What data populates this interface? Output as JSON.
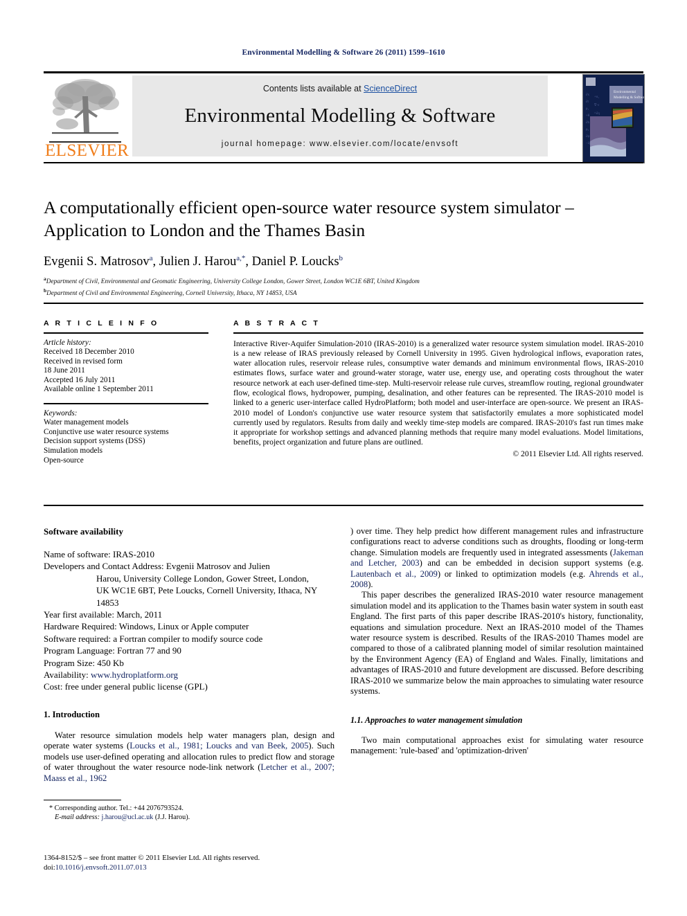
{
  "running_head": "Environmental Modelling & Software 26 (2011) 1599–1610",
  "masthead": {
    "contents_prefix": "Contents lists available at ",
    "sciencedirect": "ScienceDirect",
    "journal_title": "Environmental Modelling & Software",
    "homepage": "journal homepage: www.elsevier.com/locate/envsoft",
    "publisher": "ELSEVIER",
    "cover_title": "Environmental Modelling & Software",
    "accent_orange": "#f07d1a",
    "link_blue": "#1a4fa0",
    "cover_navy": "#0f1f4a"
  },
  "title": "A computationally efficient open-source water resource system simulator – Application to London and the Thames Basin",
  "authors": [
    {
      "name": "Evgenii S. Matrosov",
      "sup": "a"
    },
    {
      "name": "Julien J. Harou",
      "sup": "a,*"
    },
    {
      "name": "Daniel P. Loucks",
      "sup": "b"
    }
  ],
  "affiliations": [
    {
      "mark": "a",
      "text": "Department of Civil, Environmental and Geomatic Engineering, University College London, Gower Street, London WC1E 6BT, United Kingdom"
    },
    {
      "mark": "b",
      "text": "Department of Civil and Environmental Engineering, Cornell University, Ithaca, NY 14853, USA"
    }
  ],
  "article_info": {
    "heading": "A R T I C L E    I N F O",
    "history_label": "Article history:",
    "history": [
      "Received 18 December 2010",
      "Received in revised form",
      "18 June 2011",
      "Accepted 16 July 2011",
      "Available online 1 September 2011"
    ],
    "keywords_label": "Keywords:",
    "keywords": [
      "Water management models",
      "Conjunctive use water resource systems",
      "Decision support systems (DSS)",
      "Simulation models",
      "Open-source"
    ]
  },
  "abstract": {
    "heading": "A B S T R A C T",
    "text": "Interactive River-Aquifer Simulation-2010 (IRAS-2010) is a generalized water resource system simulation model. IRAS-2010 is a new release of IRAS previously released by Cornell University in 1995. Given hydrological inflows, evaporation rates, water allocation rules, reservoir release rules, consumptive water demands and minimum environmental flows, IRAS-2010 estimates flows, surface water and ground-water storage, water use, energy use, and operating costs throughout the water resource network at each user-defined time-step. Multi-reservoir release rule curves, streamflow routing, regional groundwater flow, ecological flows, hydropower, pumping, desalination, and other features can be represented. The IRAS-2010 model is linked to a generic user-interface called HydroPlatform; both model and user-interface are open-source. We present an IRAS-2010 model of London's conjunctive use water resource system that satisfactorily emulates a more sophisticated model currently used by regulators. Results from daily and weekly time-step models are compared. IRAS-2010's fast run times make it appropriate for workshop settings and advanced planning methods that require many model evaluations. Model limitations, benefits, project organization and future plans are outlined.",
    "copyright": "© 2011 Elsevier Ltd. All rights reserved."
  },
  "software_availability": {
    "heading": "Software availability",
    "items": [
      {
        "label": "Name of software:",
        "value": " IRAS-2010"
      },
      {
        "label": "Developers and Contact Address:",
        "value": " Evgenii Matrosov and Julien"
      },
      {
        "label": "",
        "value": "Harou, University College London, Gower Street, London,",
        "indent": true
      },
      {
        "label": "",
        "value": "UK WC1E 6BT, Pete Loucks, Cornell University, Ithaca, NY",
        "indent": true
      },
      {
        "label": "",
        "value": "14853",
        "indent": true
      },
      {
        "label": "Year first available:",
        "value": " March, 2011"
      },
      {
        "label": "Hardware Required:",
        "value": " Windows, Linux or Apple computer"
      },
      {
        "label": "Software required:",
        "value": " a Fortran compiler to modify source code"
      },
      {
        "label": "Program Language:",
        "value": " Fortran 77 and 90"
      },
      {
        "label": "Program Size:",
        "value": " 450 Kb"
      },
      {
        "label": "Availability:",
        "value": " www.hydroplatform.org",
        "link": true
      },
      {
        "label": "Cost:",
        "value": " free under general public license (GPL)"
      }
    ]
  },
  "introduction": {
    "heading": "1.  Introduction",
    "para1_a": "Water resource simulation models help water managers plan, design and operate water systems (",
    "para1_ref1": "Loucks et al., 1981; Loucks and van Beek, 2005",
    "para1_b": "). Such models use user-defined operating and allocation rules to predict flow and storage of water throughout the water resource node-link network (",
    "para1_ref2": "Letcher et al., 2007; Maass et al., 1962",
    "para1_c": ") over time. They help predict how different management rules and infrastructure configurations react to adverse conditions such as droughts, flooding or long-term change. Simulation models are frequently used in integrated assessments (",
    "para1_ref3": "Jakeman and Letcher, 2003",
    "para1_d": ") and can be embedded in decision support systems (e.g. ",
    "para1_ref4": "Lautenbach et al., 2009",
    "para1_e": ") or linked to optimization models (e.g. ",
    "para1_ref5": "Ahrends et al., 2008",
    "para1_f": ").",
    "para2": "This paper describes the generalized IRAS-2010 water resource management simulation model and its application to the Thames basin water system in south east England. The first parts of this paper describe IRAS-2010's history, functionality, equations and simulation procedure. Next an IRAS-2010 model of the Thames water resource system is described. Results of the IRAS-2010 Thames model are compared to those of a calibrated planning model of similar resolution maintained by the Environment Agency (EA) of England and Wales. Finally, limitations and advantages of IRAS-2010 and future development are discussed. Before describing IRAS-2010 we summarize below the main approaches to simulating water resource systems.",
    "subsection_heading": "1.1.  Approaches to water management simulation",
    "para3": "Two main computational approaches exist for simulating water resource management: 'rule-based' and 'optimization-driven'"
  },
  "footnote": {
    "corresponding": "* Corresponding author. Tel.: +44 2076793524.",
    "email_label": "E-mail address:",
    "email": " j.harou@ucl.ac.uk",
    "email_suffix": " (J.J. Harou)."
  },
  "imprint": {
    "line1": "1364-8152/$ – see front matter © 2011 Elsevier Ltd. All rights reserved.",
    "doi_label": "doi:",
    "doi": "10.1016/j.envsoft.2011.07.013"
  }
}
